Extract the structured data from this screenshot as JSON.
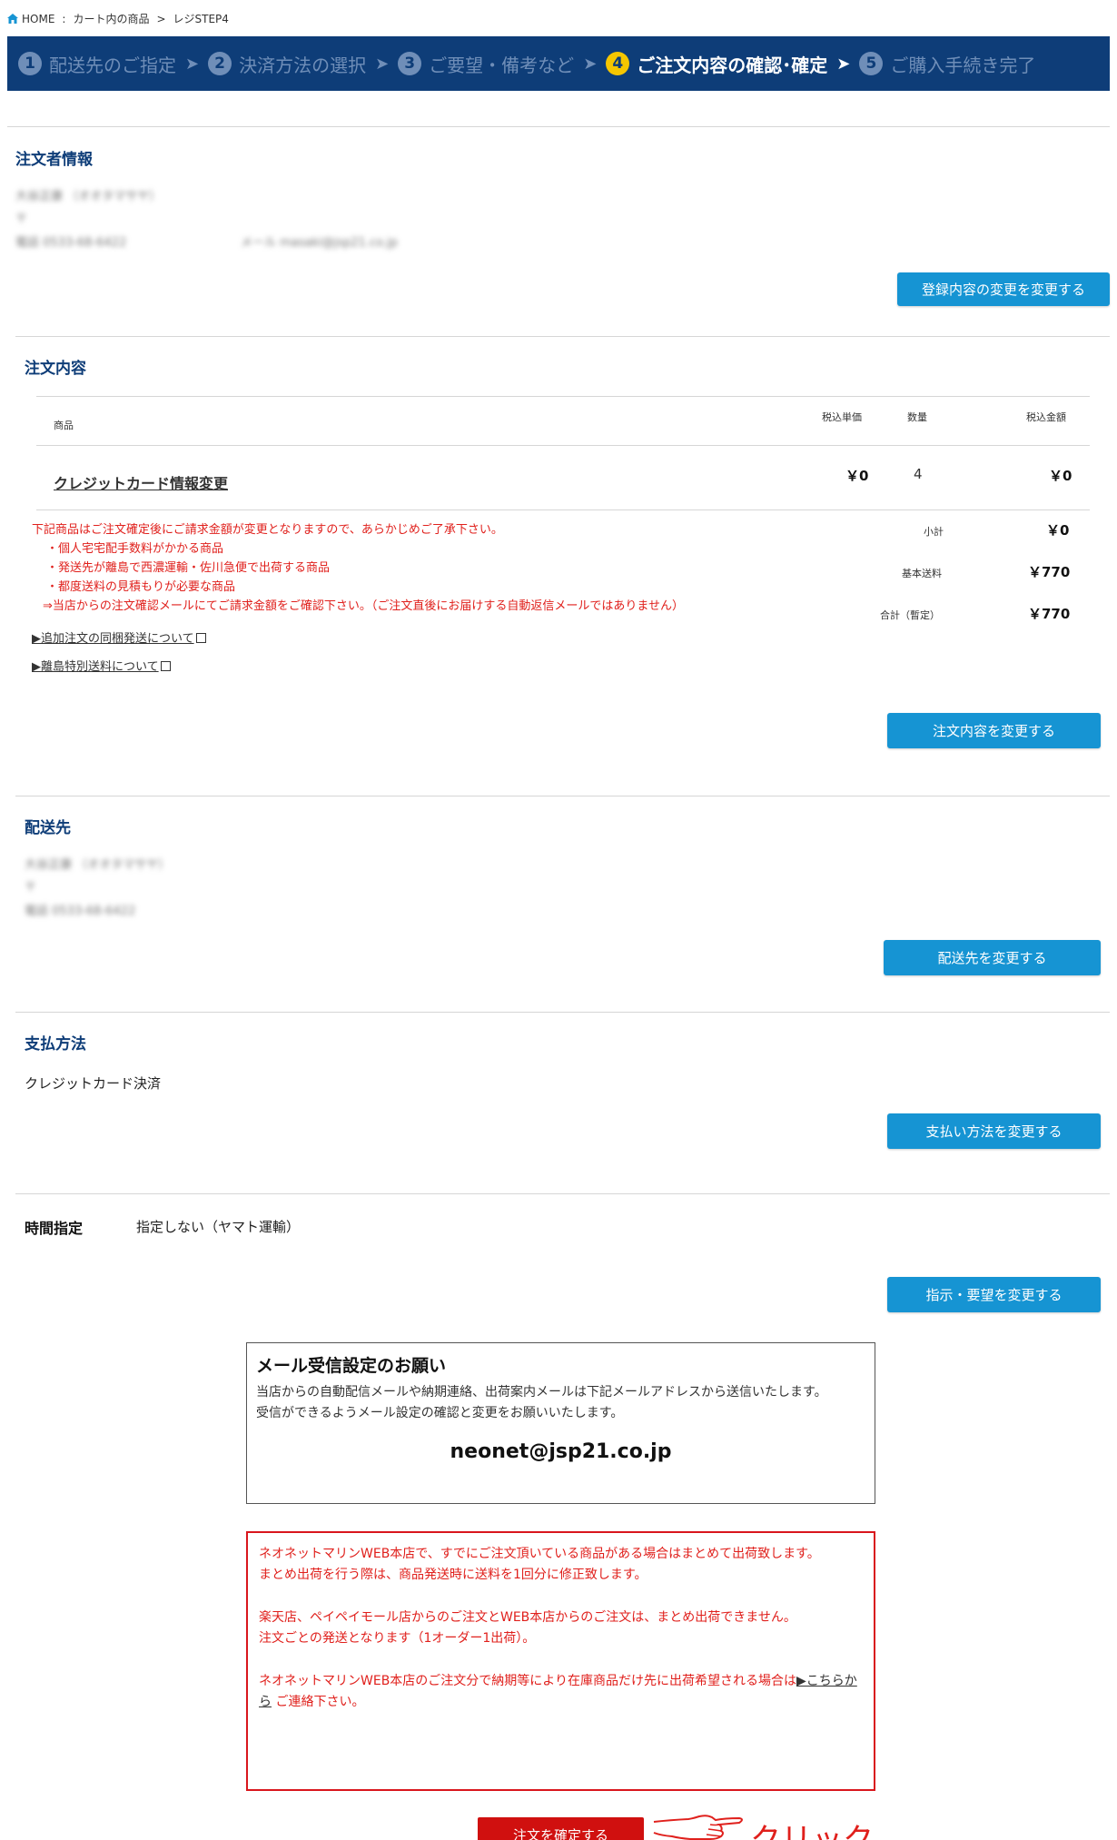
{
  "breadcrumb": {
    "home": "HOME",
    "sep1": ":",
    "cart": "カート内の商品",
    "sep2": ">",
    "current": "レジSTEP4"
  },
  "steps": [
    {
      "num": "1",
      "label": "配送先のご指定"
    },
    {
      "num": "2",
      "label": "決済方法の選択"
    },
    {
      "num": "3",
      "label": "ご要望・備考など"
    },
    {
      "num": "4",
      "label": "ご注文内容の確認･確定"
    },
    {
      "num": "5",
      "label": "ご購入手続き完了"
    }
  ],
  "orderer": {
    "title": "注文者情報",
    "line1": "大谷正康 （オオタマサヤ）",
    "line2": "〒",
    "line3a": "電話 0533-68-6422",
    "line3b": "メール masaki@jsp21.co.jp",
    "button": "登録内容の変更を変更する"
  },
  "order": {
    "title": "注文内容",
    "headers": {
      "product": "商品",
      "unit": "税込単価",
      "qty": "数量",
      "amount": "税込金額"
    },
    "item": {
      "name": "クレジットカード情報変更",
      "unit": "￥0",
      "qty": "4",
      "amount": "￥0"
    },
    "notes": [
      "下記商品はご注文確定後にご請求金額が変更となりますので、あらかじめご了承下さい。",
      "・個人宅宅配手数料がかかる商品",
      "・発送先が離島で西濃運輸・佐川急便で出荷する商品",
      "・都度送料の見積もりが必要な商品",
      "⇒当店からの注文確認メールにてご請求金額をご確認下さい。（ご注文直後にお届けする自動返信メールではありません）"
    ],
    "links": [
      "▶追加注文の同梱発送について",
      "▶離島特別送料について"
    ],
    "summary": {
      "subtotal_label": "小計",
      "subtotal": "￥0",
      "shipping_label": "基本送料",
      "shipping": "￥770",
      "total_label": "合計（暫定）",
      "total": "￥770"
    },
    "button": "注文内容を変更する"
  },
  "delivery": {
    "title": "配送先",
    "line1": "大谷正康 （オオタマサヤ）",
    "line2": "〒",
    "line3": "電話 0533-68-6422",
    "button": "配送先を変更する"
  },
  "payment": {
    "title": "支払方法",
    "method": "クレジットカード決済",
    "button": "支払い方法を変更する"
  },
  "time": {
    "label": "時間指定",
    "value": "指定しない（ヤマト運輸）",
    "button": "指示・要望を変更する"
  },
  "mailbox": {
    "heading": "メール受信設定のお願い",
    "text1": "当店からの自動配信メールや納期連絡、出荷案内メールは下記メールアドレスから送信いたします。",
    "text2": "受信ができるようメール設定の確認と変更をお願いいたします。",
    "email": "neonet@jsp21.co.jp"
  },
  "notice": {
    "p1a": "ネオネットマリンWEB本店で、すでにご注文頂いている商品がある場合はまとめて出荷致します。",
    "p1b": "まとめ出荷を行う際は、商品発送時に送料を1回分に修正致します。",
    "p2a": "楽天店、ペイペイモール店からのご注文とWEB本店からのご注文は、まとめ出荷できません。",
    "p2b": "注文ごとの発送となります（1オーダー1出荷）。",
    "p3a": "ネオネットマリンWEB本店のご注文分で納期等により在庫商品だけ先に出荷希望される場合は",
    "p3link": "▶こちらから",
    "p3b": " ご連絡下さい。"
  },
  "confirm_button": "注文を確定する",
  "click_label": "クリック",
  "colors": {
    "navy": "#0e3d78",
    "blue_button": "#1694d3",
    "red": "#e0201c",
    "active_step_badge": "#f6c600"
  }
}
